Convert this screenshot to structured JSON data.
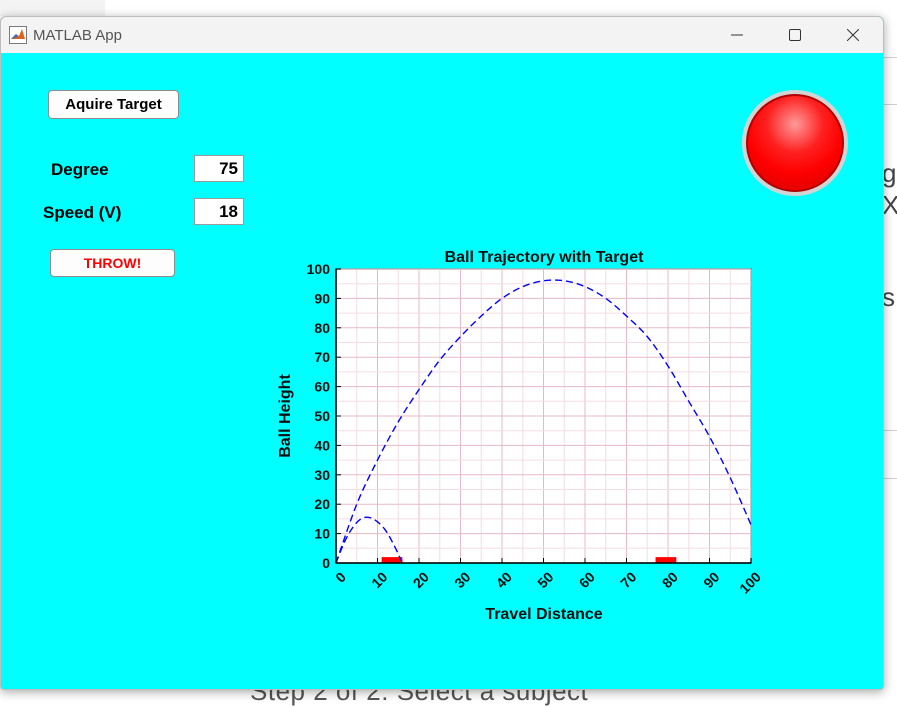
{
  "window": {
    "title": "MATLAB App"
  },
  "controls": {
    "acquire_label": "Aquire Target",
    "degree_label": "Degree",
    "degree_value": "75",
    "speed_label": "Speed (V)",
    "speed_value": "18",
    "throw_label": "THROW!",
    "lamp_color": "#ff0000"
  },
  "background_window": {
    "right_fragments": [
      "ge",
      "X_",
      "s"
    ],
    "bottom_text": "Step 2 of 2: Select a subject"
  },
  "chart_data": {
    "type": "line",
    "title": "Ball Trajectory with Target",
    "xlabel": "Travel Distance",
    "ylabel": "Ball Height",
    "xlim": [
      0,
      100
    ],
    "ylim": [
      0,
      100
    ],
    "xticks": [
      0,
      10,
      20,
      30,
      40,
      50,
      60,
      70,
      80,
      90,
      100
    ],
    "yticks": [
      0,
      10,
      20,
      30,
      40,
      50,
      60,
      70,
      80,
      90,
      100
    ],
    "grid": true,
    "series": [
      {
        "style": "dashed",
        "color": "#0000ff",
        "x": [
          0,
          2,
          4,
          6,
          8,
          10,
          12,
          14,
          16
        ],
        "y": [
          0,
          7,
          12,
          15,
          15.5,
          14,
          11,
          6,
          0
        ]
      },
      {
        "style": "dashed",
        "color": "#0000ff",
        "x": [
          0,
          5,
          10,
          15,
          20,
          25,
          30,
          35,
          40,
          45,
          50,
          55,
          60,
          65,
          70,
          75,
          80,
          85,
          90,
          95,
          100
        ],
        "y": [
          0,
          20,
          35,
          48,
          59,
          69,
          77,
          84,
          90,
          94,
          96,
          96,
          94,
          90,
          84,
          77,
          67,
          55,
          43,
          29,
          13
        ]
      }
    ],
    "targets": [
      {
        "x_start": 11,
        "x_end": 16,
        "height": 2,
        "color": "#ff0000"
      },
      {
        "x_start": 77,
        "x_end": 82,
        "height": 2,
        "color": "#ff0000"
      }
    ]
  }
}
